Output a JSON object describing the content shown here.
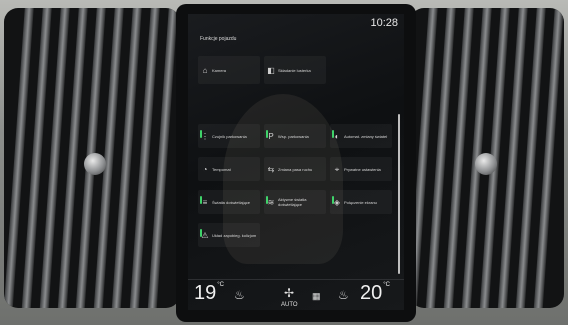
{
  "status": {
    "time": "10:28"
  },
  "title": "Funkcje pojazdu",
  "top_tiles": [
    {
      "label": "Kamera",
      "icon": "camera-icon"
    },
    {
      "label": "Składanie lusterka",
      "icon": "mirror-fold-icon"
    }
  ],
  "grid_tiles": [
    {
      "label": "Czujnik parkowania",
      "icon": "park-sensor-icon",
      "indicator": true
    },
    {
      "label": "Wsp. parkowania",
      "icon": "park-assist-icon",
      "indicator": true
    },
    {
      "label": "Automat. zmiany świateł",
      "icon": "auto-lights-icon",
      "indicator": true
    },
    {
      "label": "Tempomat",
      "icon": "cruise-control-icon",
      "indicator": false
    },
    {
      "label": "Zmiana pasa ruchu",
      "icon": "lane-change-icon",
      "indicator": false
    },
    {
      "label": "Prywatne ustawienia",
      "icon": "privacy-icon",
      "indicator": false
    },
    {
      "label": "Światła doświetlające",
      "icon": "cornering-light-icon",
      "indicator": true
    },
    {
      "label": "Aktywne światła doświetlające",
      "icon": "active-light-icon",
      "indicator": true
    },
    {
      "label": "Połączenie ekranu",
      "icon": "screen-link-icon",
      "indicator": true
    },
    {
      "label": "Układ zapobieg. kolizjom",
      "icon": "collision-icon",
      "indicator": true
    }
  ],
  "climate": {
    "left_temp": "19",
    "right_temp": "20",
    "unit": "°C",
    "fan_label": "AUTO"
  },
  "colors": {
    "indicator_on": "#3fd36a"
  }
}
